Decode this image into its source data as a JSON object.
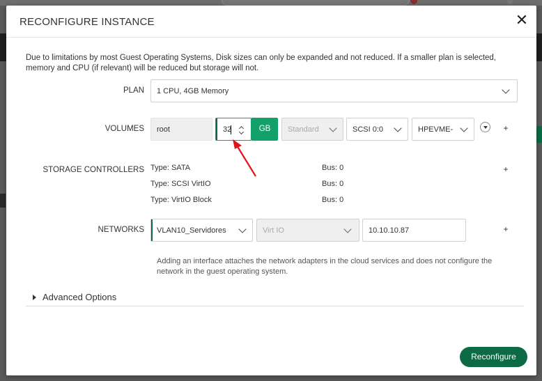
{
  "modal": {
    "title": "RECONFIGURE INSTANCE",
    "close_label": "✕",
    "notice": "Due to limitations by most Guest Operating Systems, Disk sizes can only be expanded and not reduced. If a smaller plan is selected, memory and CPU (if relevant) will be reduced but storage will not."
  },
  "plan": {
    "label": "PLAN",
    "selected": "1 CPU, 4GB Memory"
  },
  "volumes": {
    "label": "VOLUMES",
    "name": "root",
    "size": "32",
    "unit": "GB",
    "type": "Standard",
    "controller": "SCSI 0:0",
    "datastore": "HPEVME-",
    "add_label": "+"
  },
  "storage_controllers": {
    "label": "STORAGE CONTROLLERS",
    "add_label": "+",
    "items": [
      {
        "type": "Type: SATA",
        "bus": "Bus: 0"
      },
      {
        "type": "Type: SCSI VirtIO",
        "bus": "Bus: 0"
      },
      {
        "type": "Type: VirtIO Block",
        "bus": "Bus: 0"
      }
    ]
  },
  "networks": {
    "label": "NETWORKS",
    "network": "VLAN10_Servidores",
    "adapter": "Virt IO",
    "ip": "10.10.10.87",
    "add_label": "+",
    "hint": "Adding an interface attaches the network adapters in the cloud services and does not configure the network in the guest operating system."
  },
  "advanced": {
    "label": "Advanced Options"
  },
  "actions": {
    "reconfigure_label": "Reconfigure"
  },
  "colors": {
    "primary": "#0c6b45",
    "accent": "#14a06b",
    "annotation_arrow": "#e0141b"
  }
}
